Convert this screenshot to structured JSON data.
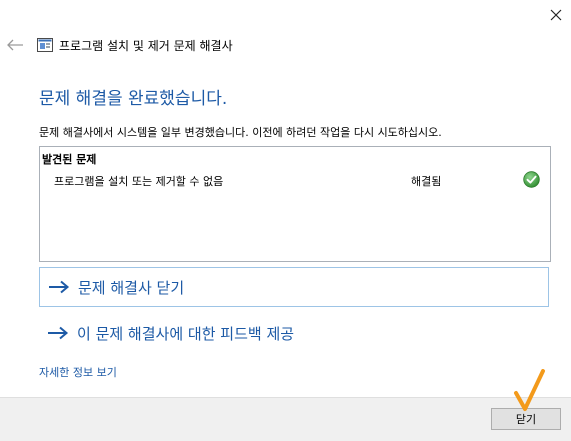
{
  "window": {
    "title": "프로그램 설치 및 제거 문제 해결사"
  },
  "content": {
    "heading": "문제 해결을 완료했습니다.",
    "description": "문제 해결사에서 시스템을 일부 변경했습니다. 이전에 하려던 작업을 다시 시도하십시오.",
    "problems": {
      "header": "발견된 문제",
      "rows": [
        {
          "name": "프로그램을 설치 또는 제거할 수 없음",
          "status": "해결됨",
          "status_icon": "check-icon"
        }
      ]
    },
    "links": {
      "close_troubleshooter": "문제 해결사 닫기",
      "feedback": "이 문제 해결사에 대한 피드백 제공",
      "details": "자세한 정보 보기"
    }
  },
  "footer": {
    "close_button": "닫기"
  },
  "colors": {
    "accent": "#1d5aa6",
    "success": "#3aa03a",
    "pointer": "#f39a1b"
  }
}
